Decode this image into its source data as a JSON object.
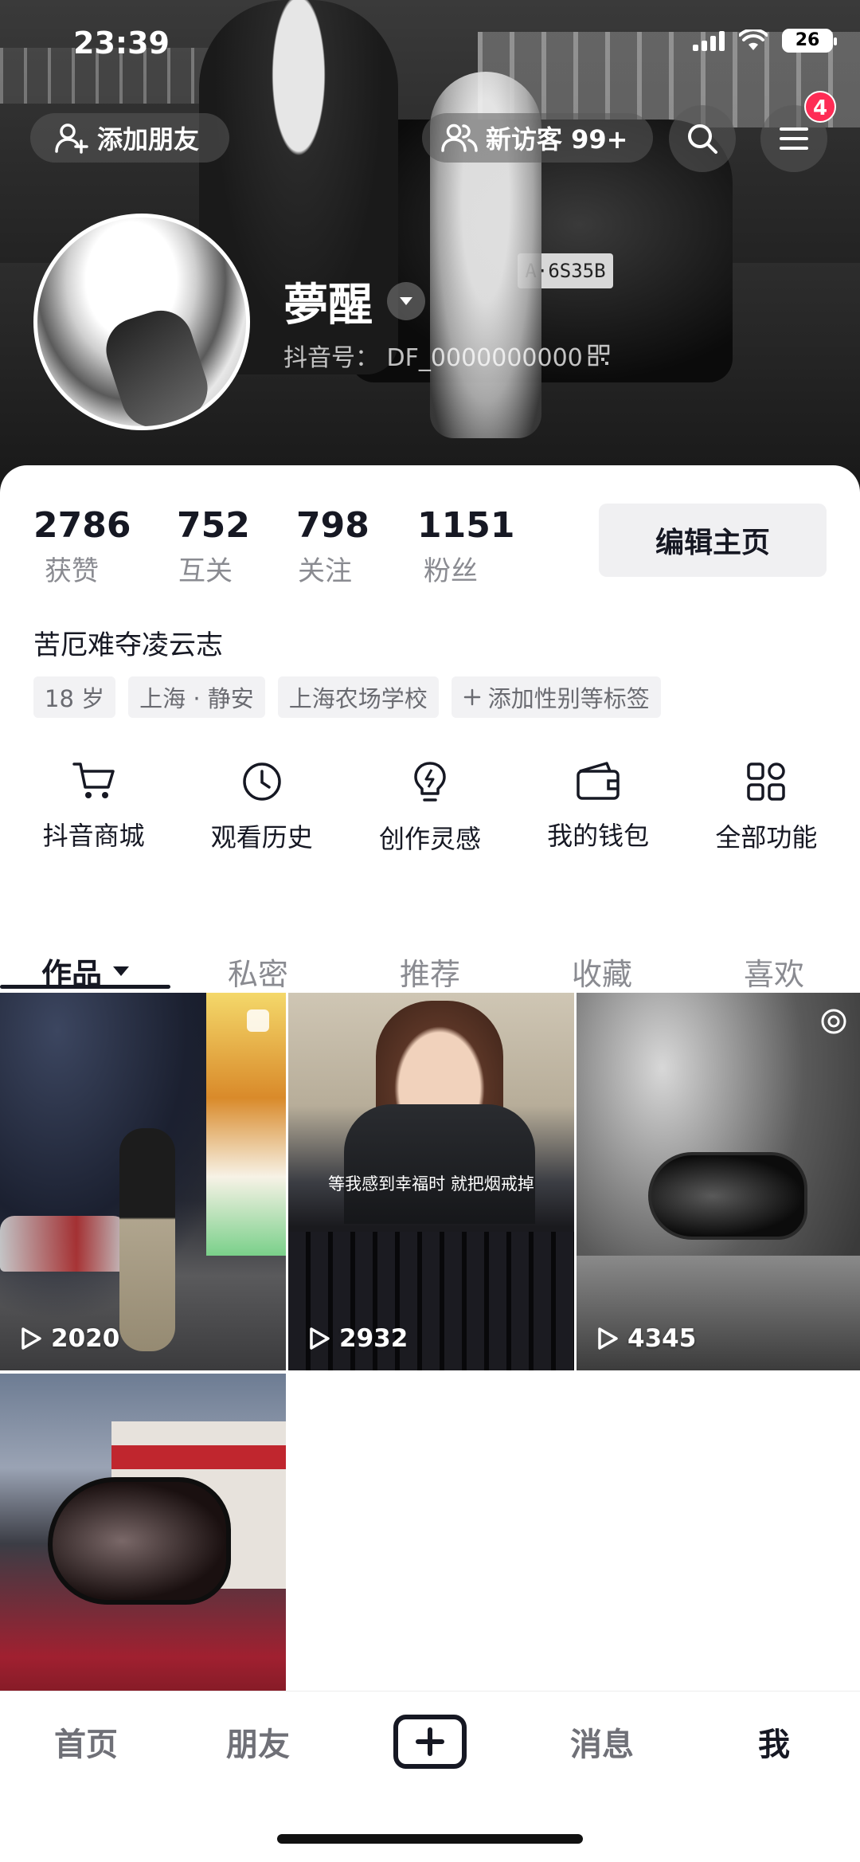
{
  "status_bar": {
    "time": "23:39",
    "battery": "26"
  },
  "header": {
    "add_friend_label": "添加朋友",
    "visitors_label": "新访客 99+",
    "menu_badge": "4",
    "plate_text": "A·6S35B"
  },
  "profile": {
    "nickname": "夢醒",
    "douyin_id": "抖音号： DF_0000000000",
    "stats": [
      {
        "value": "2786",
        "label": "获赞"
      },
      {
        "value": "752",
        "label": "互关"
      },
      {
        "value": "798",
        "label": "关注"
      },
      {
        "value": "1151",
        "label": "粉丝"
      }
    ],
    "edit_label": "编辑主页",
    "bio": "苦厄难夺凌云志",
    "tags": [
      "18 岁",
      "上海 · 静安",
      "上海农场学校",
      "添加性别等标签"
    ]
  },
  "features": [
    {
      "label": "抖音商城",
      "icon": "cart-icon"
    },
    {
      "label": "观看历史",
      "icon": "clock-icon"
    },
    {
      "label": "创作灵感",
      "icon": "lightbulb-icon"
    },
    {
      "label": "我的钱包",
      "icon": "wallet-icon"
    },
    {
      "label": "全部功能",
      "icon": "grid-icon"
    }
  ],
  "tabs": [
    "作品",
    "私密",
    "推荐",
    "收藏",
    "喜欢"
  ],
  "videos": [
    {
      "plays": "2020"
    },
    {
      "plays": "2932",
      "subtitle": "等我感到幸福时 就把烟戒掉"
    },
    {
      "plays": "4345"
    },
    {
      "plays": ""
    }
  ],
  "bottom_nav": {
    "home": "首页",
    "friends": "朋友",
    "messages": "消息",
    "me": "我"
  },
  "colors": {
    "accent": "#fe2c55",
    "text": "#161823",
    "muted": "#8a8b91"
  }
}
